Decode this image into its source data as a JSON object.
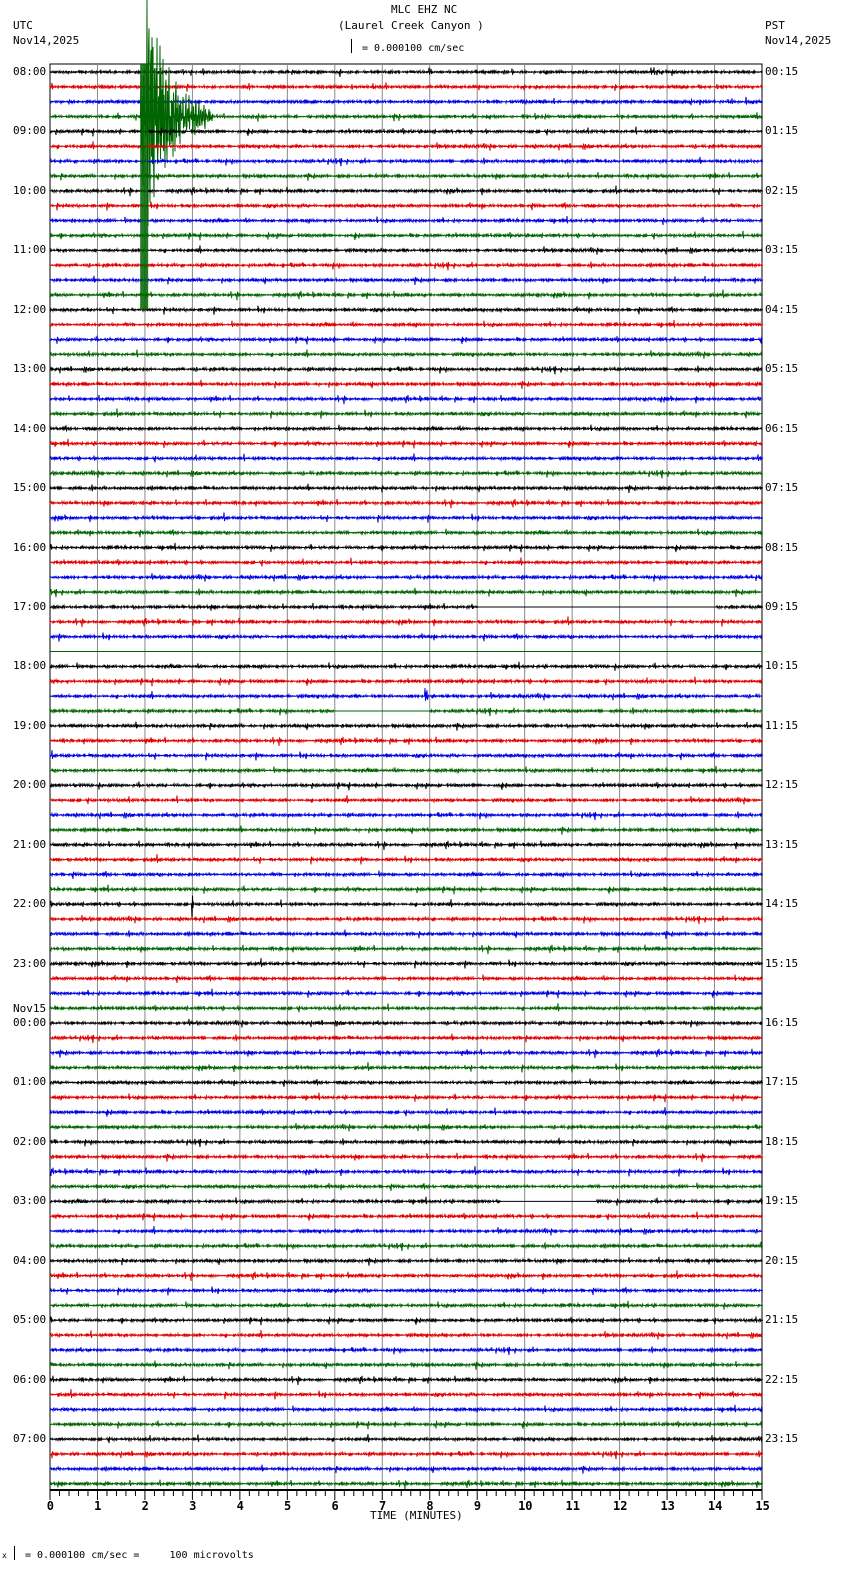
{
  "header": {
    "station": "MLC EHZ NC",
    "location": "(Laurel Creek Canyon )",
    "scale": "= 0.000100 cm/sec",
    "left_tz": "UTC",
    "left_date": "Nov14,2025",
    "right_tz": "PST",
    "right_date": "Nov14,2025"
  },
  "footer": {
    "scale_note": "= 0.000100 cm/sec =     100 microvolts",
    "mark": "x"
  },
  "chart_data": {
    "type": "line",
    "title": "MLC EHZ NC (Laurel Creek Canyon )",
    "xlabel": "TIME (MINUTES)",
    "xlim": [
      0,
      15
    ],
    "x_ticks": [
      "0",
      "1",
      "2",
      "3",
      "4",
      "5",
      "6",
      "7",
      "8",
      "9",
      "10",
      "11",
      "12",
      "13",
      "14",
      "15"
    ],
    "traces_per_hour": 4,
    "trace_colors": [
      "#000000",
      "#e00000",
      "#0000e0",
      "#006400"
    ],
    "left_labels": [
      "08:00",
      "09:00",
      "10:00",
      "11:00",
      "12:00",
      "13:00",
      "14:00",
      "15:00",
      "16:00",
      "17:00",
      "18:00",
      "19:00",
      "20:00",
      "21:00",
      "22:00",
      "23:00",
      "00:00",
      "01:00",
      "02:00",
      "03:00",
      "04:00",
      "05:00",
      "06:00",
      "07:00"
    ],
    "left_date_change": {
      "before_hour_index": 16,
      "label": "Nov15"
    },
    "right_labels": [
      "00:15",
      "01:15",
      "02:15",
      "03:15",
      "04:15",
      "05:15",
      "06:15",
      "07:15",
      "08:15",
      "09:15",
      "10:15",
      "11:15",
      "12:15",
      "13:15",
      "14:15",
      "15:15",
      "16:15",
      "17:15",
      "18:15",
      "19:15",
      "20:15",
      "21:15",
      "22:15",
      "23:15"
    ],
    "events": [
      {
        "trace": 3,
        "minute": 1.9,
        "amplitude": 12,
        "duration_min": 1.5,
        "note": "large earthquake, clipped"
      },
      {
        "trace": 3,
        "minute": 3.2,
        "amplitude": 0.6,
        "duration_min": 0.3
      },
      {
        "trace": 42,
        "minute": 7.9,
        "amplitude": 1.5,
        "duration_min": 0.2
      },
      {
        "trace": 48,
        "minute": 9.4,
        "amplitude": 0.5,
        "duration_min": 0.1
      },
      {
        "trace": 56,
        "minute": 2.95,
        "amplitude": 2.5,
        "duration_min": 0.15
      }
    ],
    "gaps": [
      {
        "trace": 36,
        "from": 9.0,
        "to": 14.0
      },
      {
        "trace": 39,
        "from": 0.0,
        "to": 15.0
      },
      {
        "trace": 43,
        "from": 6.0,
        "to": 8.0
      },
      {
        "trace": 76,
        "from": 9.5,
        "to": 11.5
      }
    ]
  }
}
